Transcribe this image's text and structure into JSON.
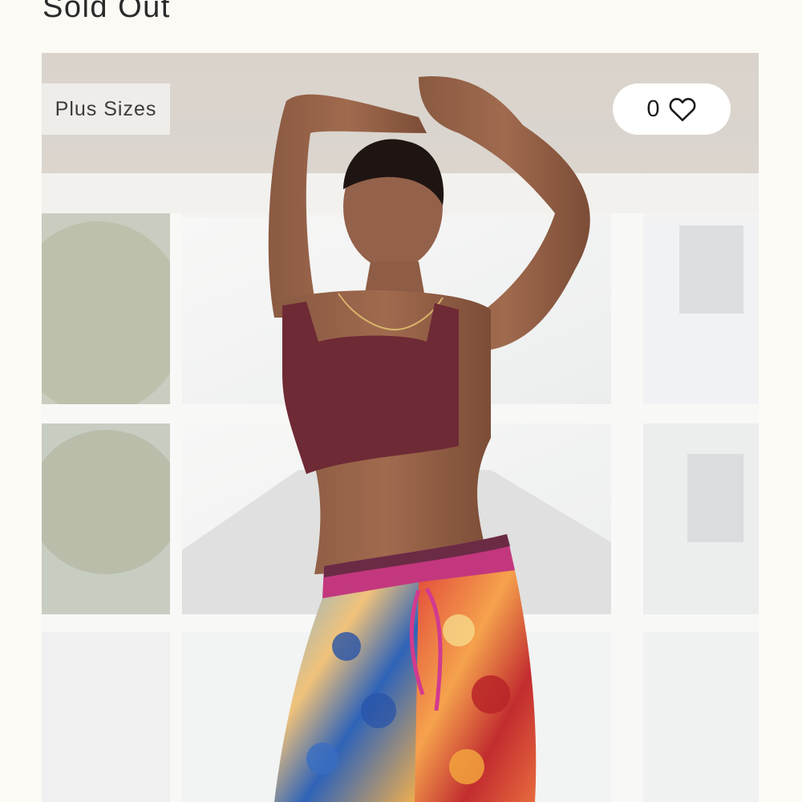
{
  "product": {
    "status": "Sold Out",
    "badge": "Plus Sizes",
    "favorites_count": "0",
    "image_alt": "Model wearing a burgundy square-neck bralette and floral patchwork jogger pants"
  },
  "icons": {
    "favorite": "heart-outline-icon"
  },
  "colors": {
    "page_background": "#fbfaf5",
    "text": "#2a2a2a",
    "badge_background": "#efedea",
    "pill_background": "#ffffff"
  }
}
